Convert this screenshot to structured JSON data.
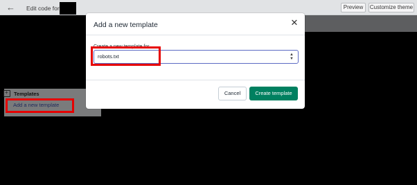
{
  "topbar": {
    "back_icon": "arrow-left-icon",
    "title": "Edit code for",
    "preview_label": "Preview",
    "customize_label": "Customize theme"
  },
  "sidebar": {
    "templates_heading": "Templates",
    "folder_icon": "folder-plus-icon",
    "add_template_link": "Add a new template"
  },
  "modal": {
    "title": "Add a new template",
    "close_icon": "close-icon",
    "field_label": "Create a new template for",
    "select_value": "robots.txt",
    "select_icon": "select-arrows-icon",
    "cancel_label": "Cancel",
    "create_label": "Create template"
  },
  "colors": {
    "primary_button": "#008060",
    "highlight": "#e60000",
    "focus_border": "#5c6ac4"
  }
}
